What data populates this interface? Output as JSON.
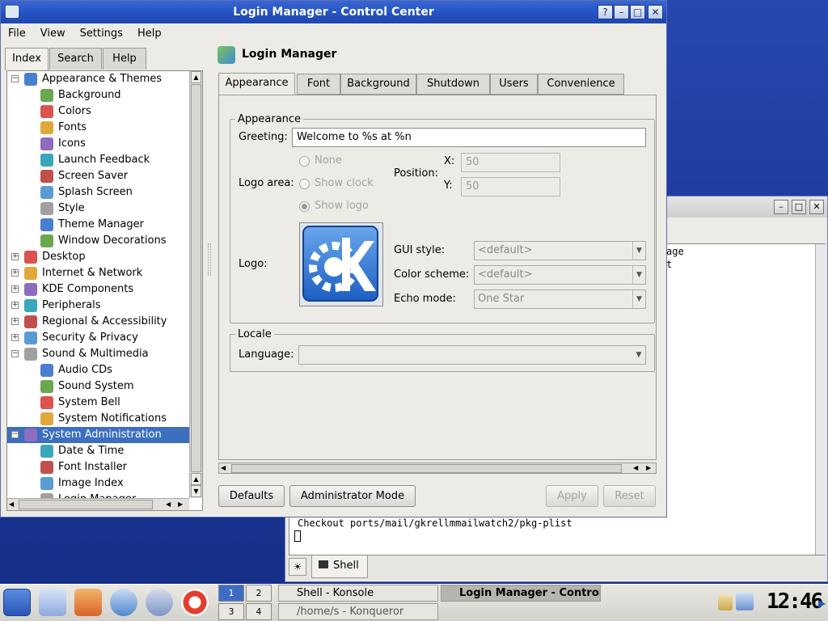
{
  "window": {
    "title": "Login Manager - Control Center",
    "buttons": [
      "?",
      "–",
      "□",
      "✕"
    ]
  },
  "menubar": [
    "File",
    "View",
    "Settings",
    "Help"
  ],
  "left_tabs": [
    "Index",
    "Search",
    "Help"
  ],
  "tree": [
    {
      "label": "Appearance & Themes",
      "level": 0,
      "expander": "−"
    },
    {
      "label": "Background",
      "level": 1
    },
    {
      "label": "Colors",
      "level": 1
    },
    {
      "label": "Fonts",
      "level": 1
    },
    {
      "label": "Icons",
      "level": 1
    },
    {
      "label": "Launch Feedback",
      "level": 1
    },
    {
      "label": "Screen Saver",
      "level": 1
    },
    {
      "label": "Splash Screen",
      "level": 1
    },
    {
      "label": "Style",
      "level": 1
    },
    {
      "label": "Theme Manager",
      "level": 1
    },
    {
      "label": "Window Decorations",
      "level": 1
    },
    {
      "label": "Desktop",
      "level": 0,
      "expander": "+"
    },
    {
      "label": "Internet & Network",
      "level": 0,
      "expander": "+"
    },
    {
      "label": "KDE Components",
      "level": 0,
      "expander": "+"
    },
    {
      "label": "Peripherals",
      "level": 0,
      "expander": "+"
    },
    {
      "label": "Regional & Accessibility",
      "level": 0,
      "expander": "+"
    },
    {
      "label": "Security & Privacy",
      "level": 0,
      "expander": "+"
    },
    {
      "label": "Sound & Multimedia",
      "level": 0,
      "expander": "−"
    },
    {
      "label": "Audio CDs",
      "level": 1
    },
    {
      "label": "Sound System",
      "level": 1
    },
    {
      "label": "System Bell",
      "level": 1
    },
    {
      "label": "System Notifications",
      "level": 1
    },
    {
      "label": "System Administration",
      "level": 0,
      "expander": "−",
      "selected": true
    },
    {
      "label": "Date & Time",
      "level": 1
    },
    {
      "label": "Font Installer",
      "level": 1
    },
    {
      "label": "Image Index",
      "level": 1
    },
    {
      "label": "Login Manager",
      "level": 1
    }
  ],
  "module": {
    "title": "Login Manager"
  },
  "tabs": [
    "Appearance",
    "Font",
    "Background",
    "Shutdown",
    "Users",
    "Convenience"
  ],
  "appearance": {
    "group_title": "Appearance",
    "greeting_label": "Greeting:",
    "greeting_value": "Welcome to %s at %n",
    "logo_area_label": "Logo area:",
    "radio_none": "None",
    "radio_clock": "Show clock",
    "radio_logo": "Show logo",
    "position_label": "Position:",
    "x_label": "X:",
    "x_value": "50",
    "y_label": "Y:",
    "y_value": "50",
    "logo_label": "Logo:",
    "gui_style_label": "GUI style:",
    "gui_style_value": "<default>",
    "color_scheme_label": "Color scheme:",
    "color_scheme_value": "<default>",
    "echo_mode_label": "Echo mode:",
    "echo_mode_value": "One Star"
  },
  "locale": {
    "group_title": "Locale",
    "language_label": "Language:",
    "language_value": ""
  },
  "bottom_buttons": {
    "defaults": "Defaults",
    "admin": "Administrator Mode",
    "apply": "Apply",
    "reset": "Reset"
  },
  "konsole": {
    "text_line1": "age",
    "text_line2": "t",
    "checkout_line": "Checkout ports/mail/gkrellmmailwatch2/pkg-plist",
    "tab_label": "Shell"
  },
  "taskbar": {
    "pager": [
      "1",
      "2",
      "3",
      "4"
    ],
    "tasks": [
      "Shell - Konsole",
      "Login Manager - Control Center",
      "/home/s - Konqueror"
    ],
    "clock": "12:46"
  },
  "colors": {
    "title_bar": "#2452c2",
    "selection": "#3c6fbd",
    "desktop": "#1f3fa3"
  }
}
